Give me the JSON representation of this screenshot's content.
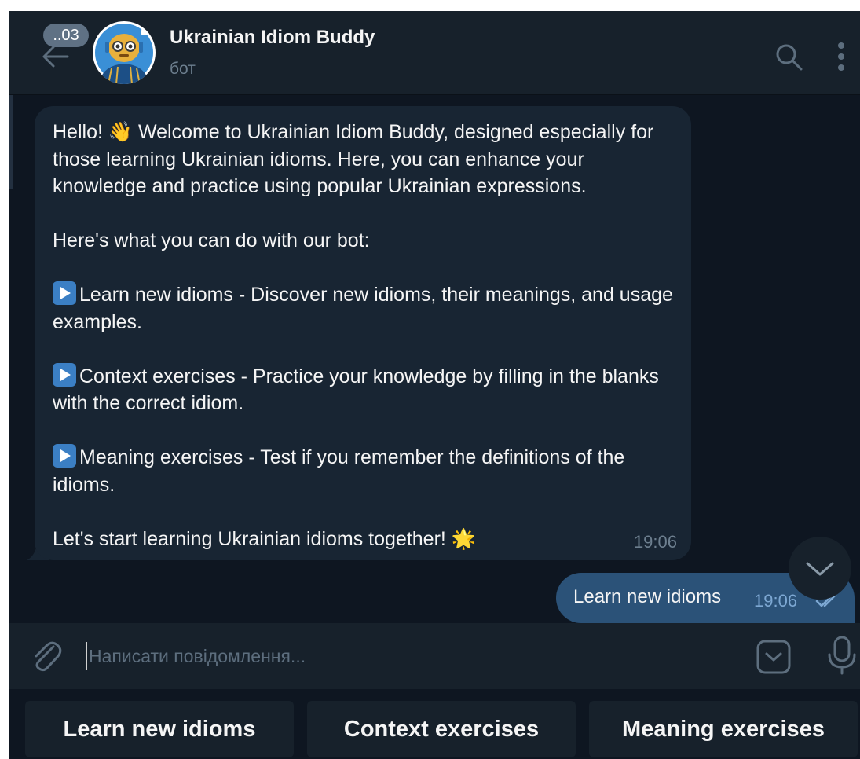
{
  "header": {
    "unread_badge": "..03",
    "title": "Ukrainian Idiom Buddy",
    "subtitle": "бот"
  },
  "messages": {
    "incoming": {
      "greeting_before": "Hello! ",
      "greeting_emoji": "👋",
      "greeting_after": " Welcome to Ukrainian Idiom Buddy, designed especially for those learning Ukrainian idioms. Here, you can enhance your knowledge and practice using popular Ukrainian expressions.",
      "intro": "Here's what you can do with our bot:",
      "feature_1": "Learn new idioms - Discover new idioms, their meanings, and usage examples.",
      "feature_2": "Context exercises - Practice your knowledge by filling in the blanks with the correct idiom.",
      "feature_3": "Meaning exercises - Test if you remember the definitions of the idioms.",
      "closing": "Let's start learning Ukrainian idioms together! ",
      "closing_emoji": "🌟",
      "time": "19:06"
    },
    "outgoing": {
      "text": "Learn new idioms",
      "time": "19:06"
    }
  },
  "composer": {
    "placeholder": "Написати повідомлення..."
  },
  "keyboard": {
    "buttons": [
      "Learn new idioms",
      "Context exercises",
      "Meaning exercises"
    ]
  },
  "colors": {
    "chat_bg": "#0e1621",
    "header_bg": "#17212b",
    "incoming_bubble": "#182533",
    "outgoing_bubble": "#2b5278",
    "accent": "#3b7fc4"
  },
  "icons": [
    "back-arrow-icon",
    "search-icon",
    "more-vertical-icon",
    "attach-icon",
    "keyboard-toggle-icon",
    "microphone-icon",
    "scroll-down-icon",
    "double-check-icon",
    "play-button-icon"
  ]
}
